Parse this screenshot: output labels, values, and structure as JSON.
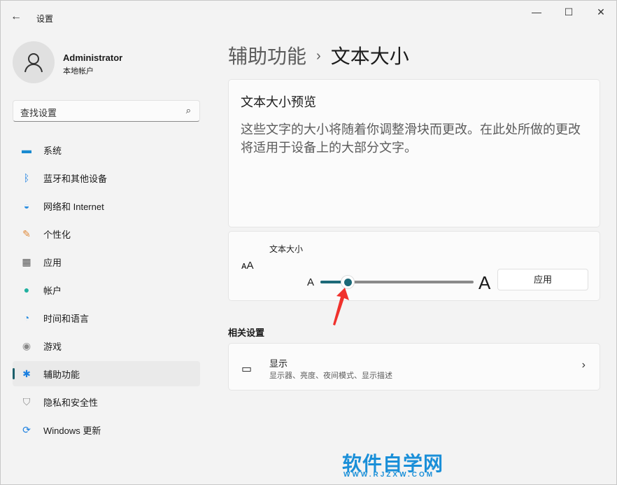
{
  "window": {
    "title": "设置",
    "back_icon": "←",
    "minimize": "—",
    "maximize": "☐",
    "close": "✕"
  },
  "user": {
    "name": "Administrator",
    "type": "本地帐户"
  },
  "search": {
    "placeholder": "查找设置",
    "icon": "⌕"
  },
  "nav": [
    {
      "label": "系统",
      "icon": "▬",
      "color": "#1a8ad0"
    },
    {
      "label": "蓝牙和其他设备",
      "icon": "ᛒ",
      "color": "#1a7fe0"
    },
    {
      "label": "网络和 Internet",
      "icon": "◒",
      "color": "#2b8ee0"
    },
    {
      "label": "个性化",
      "icon": "✎",
      "color": "#e08a3a"
    },
    {
      "label": "应用",
      "icon": "▦",
      "color": "#555"
    },
    {
      "label": "帐户",
      "icon": "●",
      "color": "#20b0a0"
    },
    {
      "label": "时间和语言",
      "icon": "◔",
      "color": "#2b8ee0"
    },
    {
      "label": "游戏",
      "icon": "◉",
      "color": "#888"
    },
    {
      "label": "辅助功能",
      "icon": "✱",
      "color": "#1a7fe0",
      "active": true
    },
    {
      "label": "隐私和安全性",
      "icon": "⛉",
      "color": "#888"
    },
    {
      "label": "Windows 更新",
      "icon": "⟳",
      "color": "#1a7fe0"
    }
  ],
  "breadcrumb": {
    "parent": "辅助功能",
    "separator": "›",
    "current": "文本大小"
  },
  "preview": {
    "title": "文本大小预览",
    "text": "这些文字的大小将随着你调整滑块而更改。在此处所做的更改将适用于设备上的大部分文字。"
  },
  "text_size": {
    "label": "文本大小",
    "icon": "ᴀA",
    "small_a": "A",
    "big_a": "A",
    "slider_fraction": 0.18,
    "apply": "应用",
    "accent": "#1c6978"
  },
  "related": {
    "heading": "相关设置",
    "items": [
      {
        "title": "显示",
        "subtitle": "显示器、亮度、夜间模式、显示描述",
        "icon": "▭",
        "chevron": "›"
      }
    ]
  },
  "watermark": {
    "text": "软件自学网",
    "url": "WWW.RJZXW.COM"
  }
}
